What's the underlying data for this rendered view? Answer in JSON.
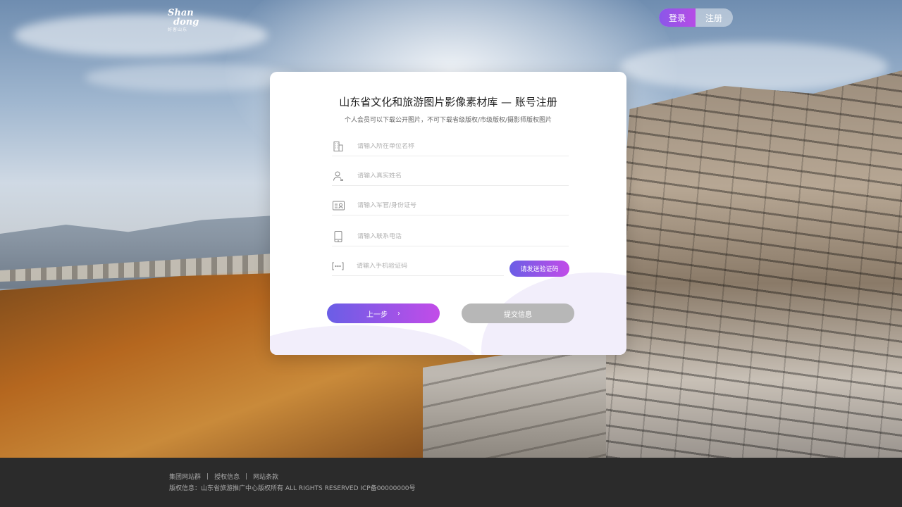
{
  "header": {
    "logo": {
      "line1": "Shan",
      "line2": "dong",
      "line3": "好客山东"
    },
    "auth": {
      "login_label": "登录",
      "register_label": "注册"
    }
  },
  "card": {
    "title": "山东省文化和旅游图片影像素材库 — 账号注册",
    "subtitle": "个人会员可以下载公开图片，不可下载省级版权/市级版权/摄影师版权图片",
    "fields": {
      "org": {
        "placeholder": "请输入所在单位名称",
        "icon": "building-icon"
      },
      "name": {
        "placeholder": "请输入真实姓名",
        "icon": "user-icon"
      },
      "id": {
        "placeholder": "请输入军官/身份证号",
        "icon": "id-card-icon"
      },
      "phone": {
        "placeholder": "请输入联系电话",
        "icon": "phone-icon"
      },
      "code": {
        "placeholder": "请输入手机验证码",
        "icon": "sms-code-icon"
      }
    },
    "send_code_label": "请发送验证码",
    "prev_label": "上一步",
    "prev_arrow": "›",
    "submit_label": "提交信息"
  },
  "footer": {
    "links": [
      "集团网站群",
      "授权信息",
      "网站条款"
    ],
    "separator": "|",
    "copyright": "版权信息：山东省旅游推广中心版权所有   ALL RIGHTS RESERVED  ICP备00000000号"
  },
  "colors": {
    "accent_start": "#6a5ee6",
    "accent_end": "#c24ce8",
    "disabled": "#b7b7b7",
    "footer_bg": "#2b2b2b"
  }
}
